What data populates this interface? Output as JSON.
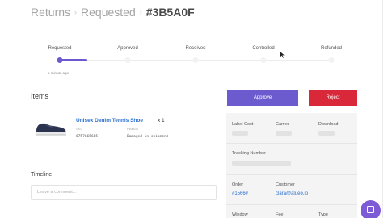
{
  "breadcrumb": {
    "root": "Returns",
    "section": "Requested",
    "current": "#3B5A0F",
    "separator": "›"
  },
  "progress": {
    "steps": [
      "Requested",
      "Approved",
      "Received",
      "Controlled",
      "Refunded"
    ],
    "active_step": 0,
    "active_fraction": 0.1,
    "timestamp": "a minute ago",
    "accent": "#6a5acd"
  },
  "items": {
    "title": "Items",
    "list": [
      {
        "name": "Unisex Denim Tennis Shoe",
        "qty": "x  1",
        "sku_label": "SKU",
        "sku": "6757665665",
        "reason_label": "Reason",
        "reason": "Damaged in shipment",
        "image_icon": "sneaker-image"
      }
    ]
  },
  "timeline": {
    "title": "Timeline",
    "placeholder": "Leave a comment..."
  },
  "actions": {
    "approve_label": "Approve",
    "approve_color": "#6c5bcf",
    "reject_label": "Reject",
    "reject_color": "#d9283a"
  },
  "details": {
    "label_cost": "Label Cost",
    "carrier": "Carrier",
    "download": "Download",
    "tracking_number": "Tracking Number",
    "order_label": "Order",
    "order_value": "#1566#",
    "customer_label": "Customer",
    "customer_value": "clara@alueo.io",
    "window_label": "Window",
    "fee_label": "Fee",
    "type_label": "Type"
  },
  "chat": {
    "icon": "chat-icon",
    "color": "#7e5bd6"
  }
}
